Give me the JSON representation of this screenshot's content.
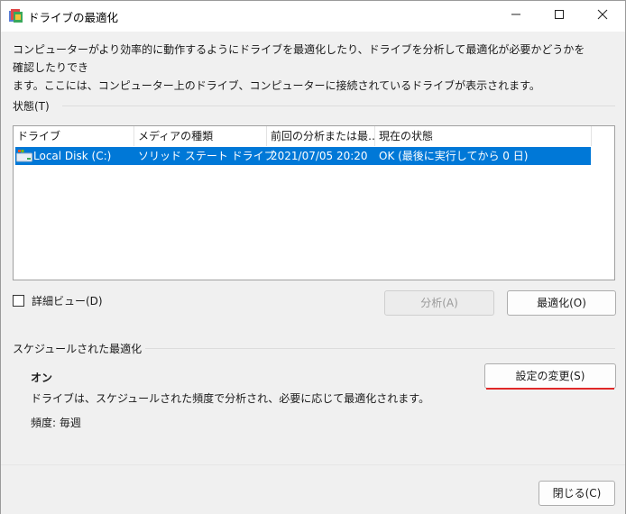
{
  "window": {
    "title": "ドライブの最適化",
    "minimize_label": "Minimize",
    "maximize_label": "Maximize",
    "close_label": "Close"
  },
  "description": "コンピューターがより効率的に動作するようにドライブを最適化したり、ドライブを分析して最適化が必要かどうかを確認したりでき\nます。ここには、コンピューター上のドライブ、コンピューターに接続されているドライブが表示されます。",
  "status": {
    "group_label": "状態(T)",
    "columns": [
      "ドライブ",
      "メディアの種類",
      "前回の分析または最…",
      "現在の状態"
    ],
    "rows": [
      {
        "drive": "Local Disk (C:)",
        "media_type": "ソリッド ステート ドライブ",
        "last_run": "2021/07/05 20:20",
        "current_status": "OK (最後に実行してから 0 日)",
        "selected": true
      }
    ]
  },
  "advanced_view": {
    "label": "詳細ビュー(D)",
    "checked": false
  },
  "buttons": {
    "analyze": "分析(A)",
    "optimize": "最適化(O)",
    "change_settings": "設定の変更(S)",
    "close": "閉じる(C)"
  },
  "schedule": {
    "group_label": "スケジュールされた最適化",
    "state": "オン",
    "description": "ドライブは、スケジュールされた頻度で分析され、必要に応じて最適化されます。",
    "frequency": "頻度: 毎週"
  },
  "colors": {
    "selection": "#0078d7",
    "focus_underline": "#e02828"
  }
}
